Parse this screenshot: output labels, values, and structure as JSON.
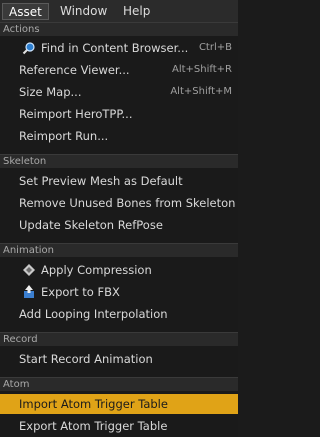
{
  "menubar": {
    "items": [
      {
        "label": "Asset",
        "active": true
      },
      {
        "label": "Window",
        "active": false
      },
      {
        "label": "Help",
        "active": false
      }
    ]
  },
  "colors": {
    "highlight": "#e0a317",
    "section_bg": "#2a2a2a",
    "panel_bg": "#1a1a1a"
  },
  "sections": {
    "actions": {
      "title": "Actions",
      "items": [
        {
          "label": "Find in Content Browser...",
          "shortcut": "Ctrl+B",
          "icon": "search-icon"
        },
        {
          "label": "Reference Viewer...",
          "shortcut": "Alt+Shift+R"
        },
        {
          "label": "Size Map...",
          "shortcut": "Alt+Shift+M"
        },
        {
          "label": "Reimport HeroTPP..."
        },
        {
          "label": "Reimport Run..."
        }
      ]
    },
    "skeleton": {
      "title": "Skeleton",
      "items": [
        {
          "label": "Set Preview Mesh as Default"
        },
        {
          "label": "Remove Unused Bones from Skeleton"
        },
        {
          "label": "Update Skeleton RefPose"
        }
      ]
    },
    "animation": {
      "title": "Animation",
      "items": [
        {
          "label": "Apply Compression",
          "icon": "compress-icon"
        },
        {
          "label": "Export to FBX",
          "icon": "export-icon"
        },
        {
          "label": "Add Looping Interpolation"
        }
      ]
    },
    "record": {
      "title": "Record",
      "items": [
        {
          "label": "Start Record Animation"
        }
      ]
    },
    "atom": {
      "title": "Atom",
      "items": [
        {
          "label": "Import Atom Trigger Table",
          "highlighted": true
        },
        {
          "label": "Export Atom Trigger Table"
        }
      ]
    }
  }
}
